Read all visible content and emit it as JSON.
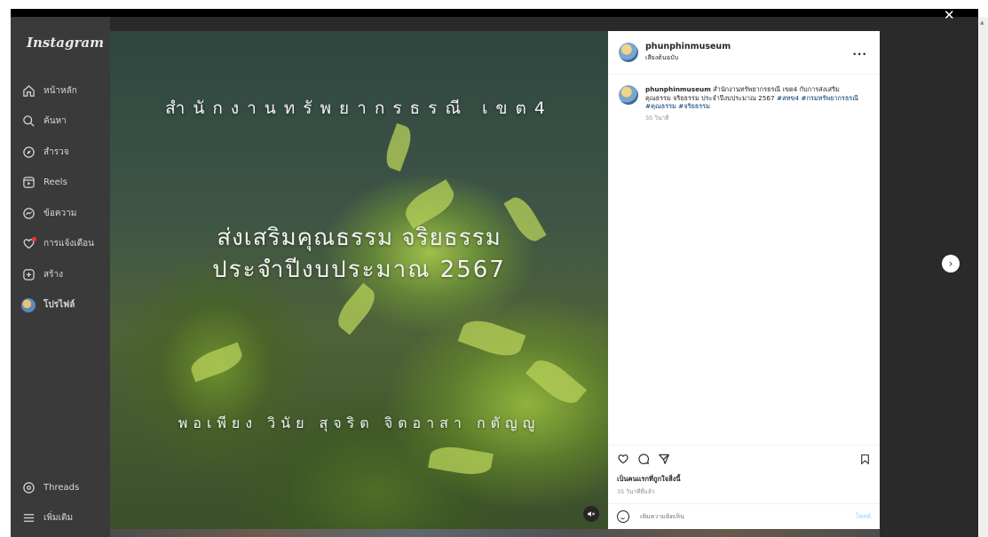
{
  "sidebar": {
    "logo": "Instagram",
    "items": [
      {
        "label": "หน้าหลัก",
        "icon": "home-icon"
      },
      {
        "label": "ค้นหา",
        "icon": "search-icon"
      },
      {
        "label": "สำรวจ",
        "icon": "explore-icon"
      },
      {
        "label": "Reels",
        "icon": "reels-icon"
      },
      {
        "label": "ข้อความ",
        "icon": "messenger-icon"
      },
      {
        "label": "การแจ้งเตือน",
        "icon": "heart-icon"
      },
      {
        "label": "สร้าง",
        "icon": "create-icon"
      },
      {
        "label": "โปรไฟล์",
        "icon": "profile-avatar"
      }
    ],
    "bottom": [
      {
        "label": "Threads",
        "icon": "threads-icon"
      },
      {
        "label": "เพิ่มเติม",
        "icon": "menu-icon"
      }
    ]
  },
  "post_image": {
    "line1": "สำนักงานทรัพยากรธรณี เขต4",
    "line2": "ส่งเสริมคุณธรรม จริยธรรม",
    "line3": "ประจำปีงบประมาณ 2567",
    "line4": "พอเพียง วินัย สุจริต จิตอาสา กตัญญู",
    "mute_icon": "muted-audio-icon"
  },
  "post": {
    "username": "phunphinmuseum",
    "subline": "เสียงต้นฉบับ",
    "more": "...",
    "caption_user": "phunphinmuseum",
    "caption_text": "สำนักงานทรัพยากรธรณี เขต4 กับการส่งเสริมคุณธรรม จริยธรรม ประจำปีงบประมาณ 2567",
    "hashtags": "#สทข4 #กรมทรัพยากรธรณี #คุณธรรม #จริยธรรม",
    "caption_time": "35 วินาที",
    "likes_text": "เป็นคนแรกที่ถูกใจสิ่งนี้",
    "post_time": "35 วินาทีที่แล้ว",
    "comment_placeholder": "เพิ่มความคิดเห็น",
    "post_label": "โพสต์"
  },
  "overlay": {
    "close": "✕",
    "next": "›"
  }
}
